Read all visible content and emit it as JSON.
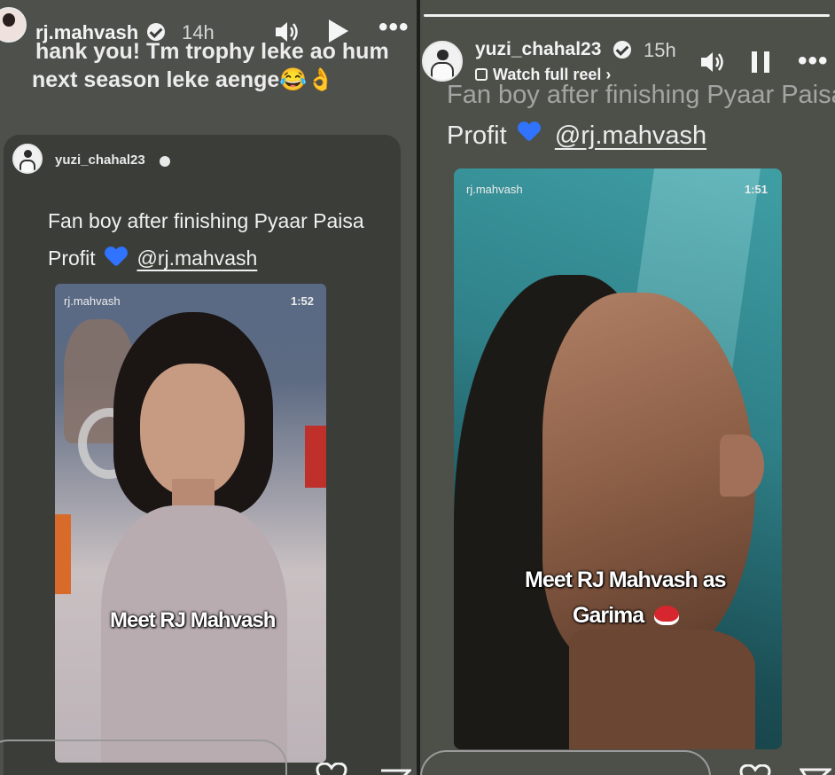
{
  "left_story": {
    "username": "rj.mahvash",
    "timestamp": "14h",
    "caption_line1": "hank you! Tm trophy leke ao hum",
    "caption_line2": "next season leke aenge😂👌",
    "shared_post": {
      "username": "yuzi_chahal23",
      "text_line1": "Fan boy after finishing Pyaar Paisa",
      "text_line2_prefix": "Profit",
      "mention": "@rj.mahvash",
      "reel": {
        "owner": "rj.mahvash",
        "duration": "1:52",
        "overlay": "Meet RJ Mahvash"
      }
    }
  },
  "right_story": {
    "username": "yuzi_chahal23",
    "timestamp": "15h",
    "watch_full_reel": "Watch full reel",
    "caption_line1": "Fan boy after finishing Pyaar Paisa",
    "caption_line2_prefix": "Profit",
    "mention": "@rj.mahvash",
    "reel": {
      "owner": "rj.mahvash",
      "duration": "1:51",
      "overlay_line1": "Meet RJ Mahvash as",
      "overlay_line2": "Garima"
    }
  },
  "icons": {
    "volume": "volume-icon",
    "play": "play-icon",
    "pause": "pause-icon",
    "more": "more-icon",
    "verified": "verified-badge-icon",
    "heart": "heart-icon",
    "send": "send-icon"
  },
  "colors": {
    "story_bg": "#4e504b",
    "card_bg": "#3b3d38",
    "heart_blue": "#2f73ff",
    "reel_teal": "#2f8088"
  }
}
